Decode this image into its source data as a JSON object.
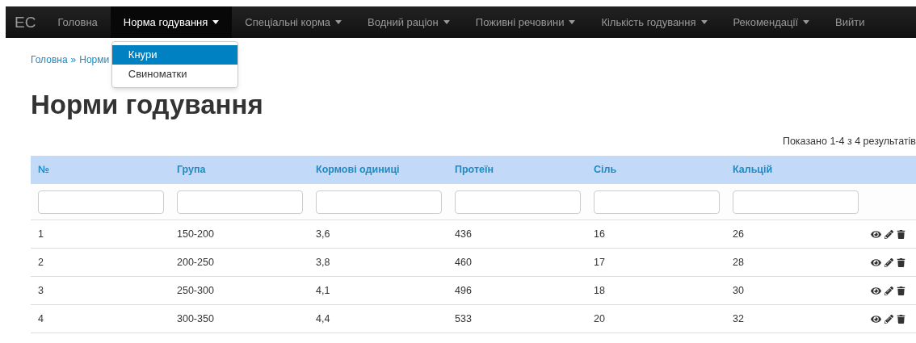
{
  "navbar": {
    "brand": "EC",
    "items": [
      {
        "label": "Головна",
        "selected": false,
        "kind": "link"
      },
      {
        "label": "Норма годування",
        "selected": true,
        "kind": "dropdown",
        "menu": [
          {
            "label": "Кнури",
            "selected": true
          },
          {
            "label": "Свиноматки",
            "selected": false
          }
        ]
      },
      {
        "label": "Спеціальні корма",
        "selected": false,
        "kind": "dropdown"
      },
      {
        "label": "Водний раціон",
        "selected": false,
        "kind": "dropdown"
      },
      {
        "label": "Поживні речовини",
        "selected": false,
        "kind": "dropdown"
      },
      {
        "label": "Кількість годування",
        "selected": false,
        "kind": "dropdown"
      },
      {
        "label": "Рекомендації",
        "selected": false,
        "kind": "dropdown"
      },
      {
        "label": "Вийти",
        "selected": false,
        "kind": "link"
      }
    ]
  },
  "breadcrumb": {
    "home": "Головна",
    "separator": "»",
    "current": "Норми"
  },
  "heading": "Норми годування",
  "summary": "Показано 1-4 з 4 результатів",
  "table": {
    "columns": [
      "№",
      "Група",
      "Кормові одиниці",
      "Протеїн",
      "Сіль",
      "Кальцій"
    ],
    "rows": [
      [
        "1",
        "150-200",
        "3,6",
        "436",
        "16",
        "26"
      ],
      [
        "2",
        "200-250",
        "3,8",
        "460",
        "17",
        "28"
      ],
      [
        "3",
        "250-300",
        "4,1",
        "496",
        "18",
        "30"
      ],
      [
        "4",
        "300-350",
        "4,4",
        "533",
        "20",
        "32"
      ]
    ]
  }
}
